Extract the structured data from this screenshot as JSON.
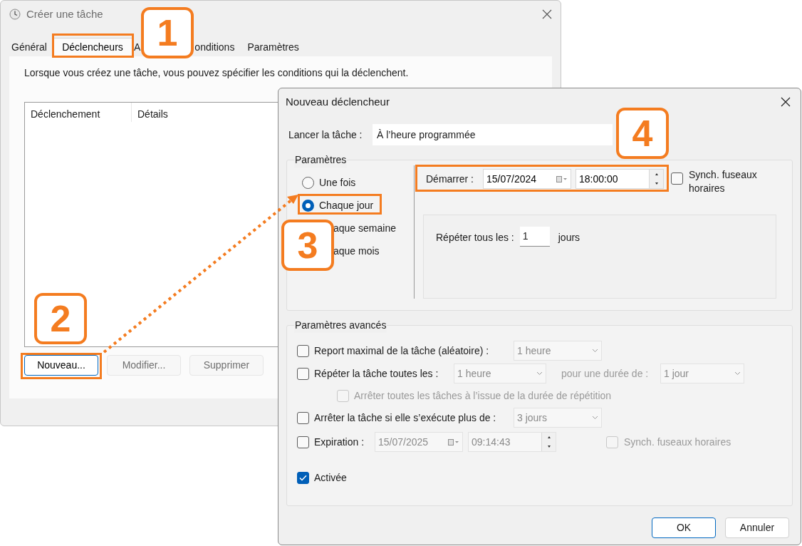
{
  "back_window": {
    "title": "Créer une tâche",
    "tabs": [
      {
        "label": "Général",
        "selected": false
      },
      {
        "label": "Déclencheurs",
        "selected": true
      },
      {
        "label": "A",
        "selected": false
      },
      {
        "label": "onditions",
        "selected": false
      },
      {
        "label": "Paramètres",
        "selected": false
      }
    ],
    "description": "Lorsque vous créez une tâche, vous pouvez spécifier les conditions qui la déclenchent.",
    "list_columns": [
      "Déclenchement",
      "Détails"
    ],
    "buttons": [
      {
        "label": "Nouveau...",
        "disabled": false
      },
      {
        "label": "Modifier...",
        "disabled": true
      },
      {
        "label": "Supprimer",
        "disabled": true
      }
    ]
  },
  "dialog": {
    "title": "Nouveau déclencheur",
    "launch": {
      "label": "Lancer la tâche :",
      "value": "À l’heure programmée"
    },
    "settings": {
      "legend": "Paramètres",
      "schedule_options": [
        {
          "label": "Une fois",
          "selected": false
        },
        {
          "label": "Chaque jour",
          "selected": true
        }
      ],
      "obscured_options": [
        "aque semaine",
        "aque mois"
      ],
      "start": {
        "label": "Démarrer :",
        "date": "15/07/2024",
        "time": "18:00:00"
      },
      "sync": {
        "label": "Synch. fuseaux horaires",
        "checked": false
      },
      "repeat": {
        "label": "Répéter tous les :",
        "value": "1",
        "unit": "jours"
      }
    },
    "advanced": {
      "legend": "Paramètres avancés",
      "rows": [
        {
          "kind": "combo",
          "label": "Report maximal de la tâche (aléatoire) :",
          "checked": false,
          "value": "1 heure"
        },
        {
          "kind": "repeat",
          "label": "Répéter la tâche toutes les :",
          "checked": false,
          "value": "1 heure",
          "duration_label": "pour une durée de :",
          "duration": "1 jour"
        },
        {
          "kind": "sub",
          "label": "Arrêter toutes les tâches à l’issue de la durée de répétition",
          "checked": false,
          "disabled": true
        },
        {
          "kind": "combo",
          "label": "Arrêter la tâche si elle s’exécute plus de :",
          "checked": false,
          "value": "3 jours"
        },
        {
          "kind": "expiration",
          "label": "Expiration :",
          "checked": false,
          "date": "15/07/2025",
          "time": "09:14:43",
          "sync_label": "Synch. fuseaux horaires",
          "sync_checked": false
        },
        {
          "kind": "check",
          "label": "Activée",
          "checked": true
        }
      ]
    },
    "buttons": [
      {
        "label": "OK",
        "default": true
      },
      {
        "label": "Annuler",
        "default": false
      }
    ]
  },
  "annotations": [
    {
      "number": "1"
    },
    {
      "number": "2"
    },
    {
      "number": "3"
    },
    {
      "number": "4"
    }
  ]
}
